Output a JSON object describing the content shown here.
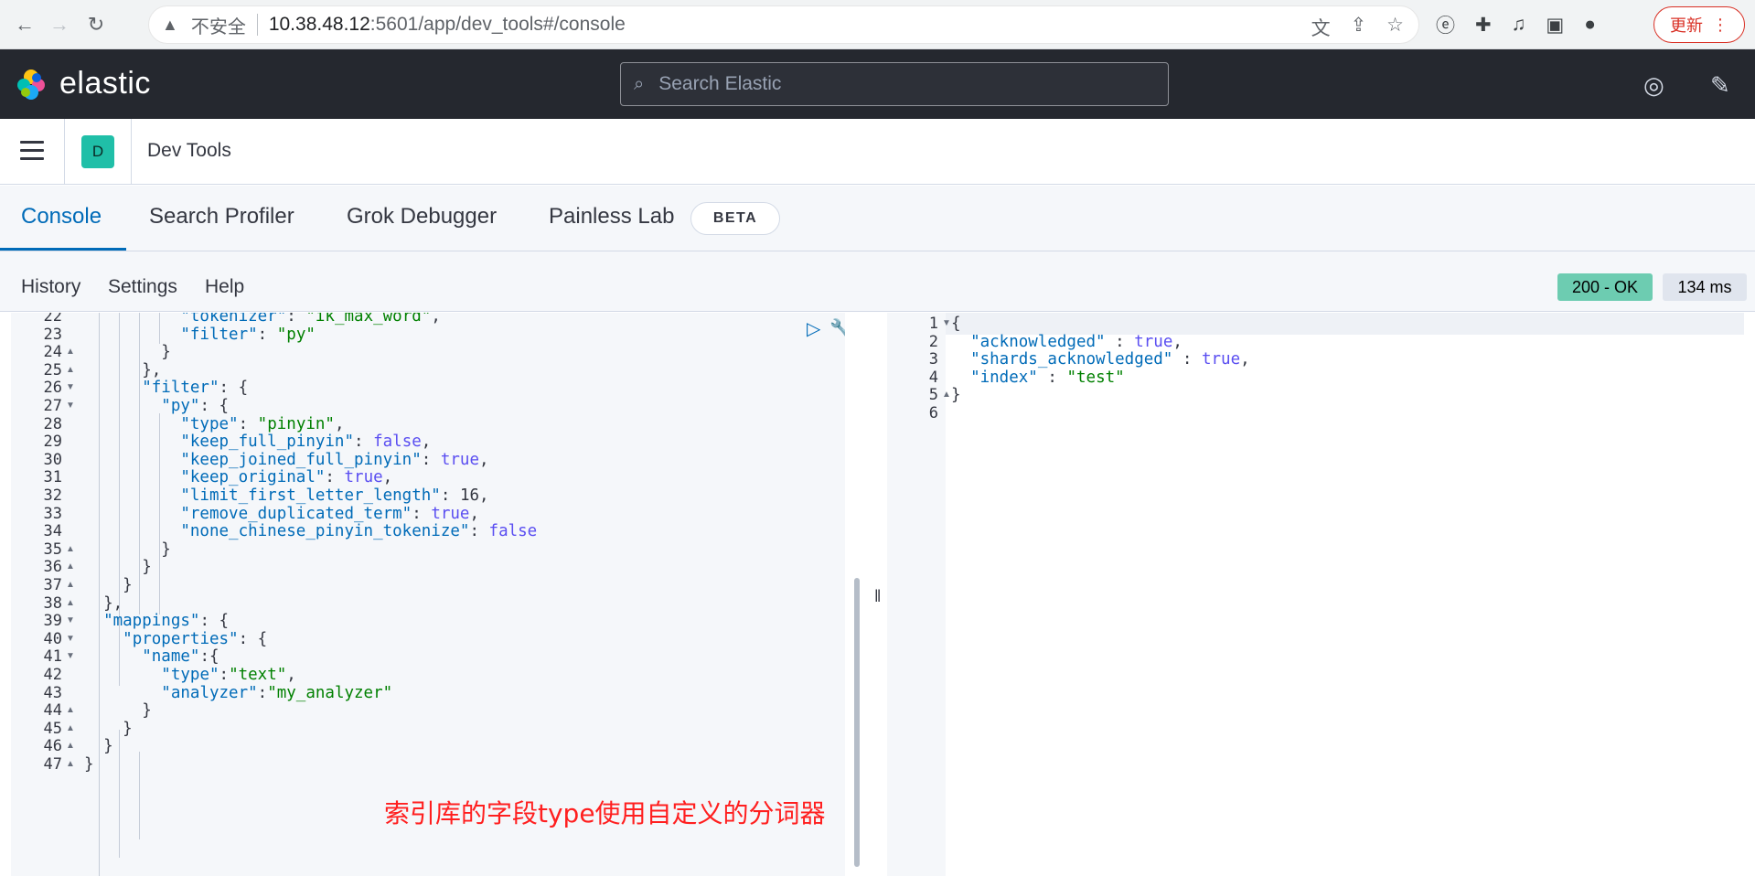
{
  "browser": {
    "insecure_label": "不安全",
    "url_host": "10.38.48.12",
    "url_path": ":5601/app/dev_tools#/console",
    "update_label": "更新"
  },
  "header": {
    "logo_text": "elastic",
    "search_placeholder": "Search Elastic"
  },
  "appbar": {
    "space_initial": "D",
    "breadcrumb": "Dev Tools"
  },
  "tabs": [
    {
      "label": "Console",
      "active": true
    },
    {
      "label": "Search Profiler"
    },
    {
      "label": "Grok Debugger"
    },
    {
      "label": "Painless Lab"
    }
  ],
  "beta_badge": "BETA",
  "toolbar": {
    "history": "History",
    "settings": "Settings",
    "help": "Help",
    "status": "200 - OK",
    "time": "134 ms"
  },
  "request_lines": [
    {
      "n": "22",
      "fold": "",
      "text": "          \"tokenizer\": \"ik_max_word\","
    },
    {
      "n": "23",
      "fold": "",
      "text": "          \"filter\": \"py\""
    },
    {
      "n": "24",
      "fold": "▲",
      "text": "        }"
    },
    {
      "n": "25",
      "fold": "▲",
      "text": "      },"
    },
    {
      "n": "26",
      "fold": "▼",
      "text": "      \"filter\": {"
    },
    {
      "n": "27",
      "fold": "▼",
      "text": "        \"py\": {"
    },
    {
      "n": "28",
      "fold": "",
      "text": "          \"type\": \"pinyin\","
    },
    {
      "n": "29",
      "fold": "",
      "text": "          \"keep_full_pinyin\": false,"
    },
    {
      "n": "30",
      "fold": "",
      "text": "          \"keep_joined_full_pinyin\": true,"
    },
    {
      "n": "31",
      "fold": "",
      "text": "          \"keep_original\": true,"
    },
    {
      "n": "32",
      "fold": "",
      "text": "          \"limit_first_letter_length\": 16,"
    },
    {
      "n": "33",
      "fold": "",
      "text": "          \"remove_duplicated_term\": true,"
    },
    {
      "n": "34",
      "fold": "",
      "text": "          \"none_chinese_pinyin_tokenize\": false"
    },
    {
      "n": "35",
      "fold": "▲",
      "text": "        }"
    },
    {
      "n": "36",
      "fold": "▲",
      "text": "      }"
    },
    {
      "n": "37",
      "fold": "▲",
      "text": "    }"
    },
    {
      "n": "38",
      "fold": "▲",
      "text": "  },"
    },
    {
      "n": "39",
      "fold": "▼",
      "text": "  \"mappings\": {"
    },
    {
      "n": "40",
      "fold": "▼",
      "text": "    \"properties\": {"
    },
    {
      "n": "41",
      "fold": "▼",
      "text": "      \"name\":{"
    },
    {
      "n": "42",
      "fold": "",
      "text": "        \"type\":\"text\","
    },
    {
      "n": "43",
      "fold": "",
      "text": "        \"analyzer\":\"my_analyzer\""
    },
    {
      "n": "44",
      "fold": "▲",
      "text": "      }"
    },
    {
      "n": "45",
      "fold": "▲",
      "text": "    }"
    },
    {
      "n": "46",
      "fold": "▲",
      "text": "  }"
    },
    {
      "n": "47",
      "fold": "▲",
      "text": "}"
    }
  ],
  "response_lines": [
    {
      "n": "1",
      "fold": "▼",
      "text": "{"
    },
    {
      "n": "2",
      "fold": "",
      "text": "  \"acknowledged\" : true,"
    },
    {
      "n": "3",
      "fold": "",
      "text": "  \"shards_acknowledged\" : true,"
    },
    {
      "n": "4",
      "fold": "",
      "text": "  \"index\" : \"test\""
    },
    {
      "n": "5",
      "fold": "▲",
      "text": "}"
    },
    {
      "n": "6",
      "fold": "",
      "text": ""
    }
  ],
  "annotation": "索引库的字段type使用自定义的分词器",
  "icons": {
    "back": "arrow-left-icon",
    "forward": "arrow-right-icon",
    "reload": "reload-icon",
    "warning": "warning-icon",
    "translate": "translate-icon",
    "share": "share-icon",
    "star": "star-icon",
    "search": "search-icon",
    "help": "help-icon",
    "news": "newsfeed-icon",
    "run": "play-icon",
    "wrench": "wrench-icon"
  },
  "colors": {
    "accent": "#006bb8",
    "header_bg": "#25282f",
    "status_ok": "#6dccb1",
    "annotation": "#ff1f1f"
  }
}
